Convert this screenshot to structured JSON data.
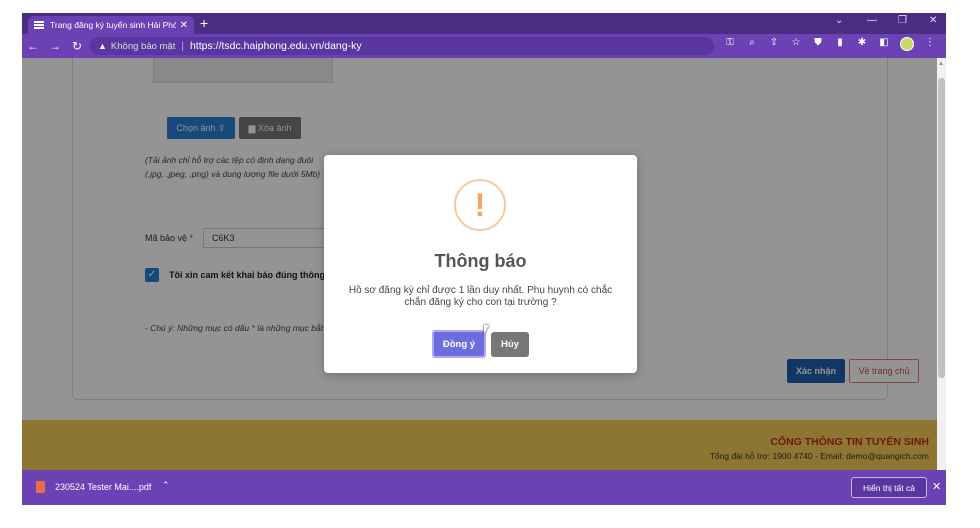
{
  "browser": {
    "tab_title": "Trang đăng ký tuyển sinh Hải Phò",
    "new_tab": "+",
    "tab_close": "✕",
    "security_label": "Không bảo mật",
    "url_scheme": "https://",
    "url_host": "tsdc.haiphong.edu.vn",
    "url_path": "/dang-ky",
    "window_controls": {
      "minimize": "—",
      "restore": "❐",
      "close": "✕",
      "tab_list": "⌄"
    }
  },
  "form": {
    "choose_photo_label": "Chọn ảnh",
    "delete_photo_label": "Xóa ảnh",
    "photo_note_line1": "(Tải ảnh chỉ hỗ trợ các tệp có định dạng đuôi",
    "photo_note_line2": "(.jpg, .jpeg, .png) và dung lượng file dưới 5Mb)",
    "captcha_label": "Mã bảo vệ",
    "required_mark": "*",
    "captcha_value": "C6K3",
    "commit_label": "Tôi xin cam kết khai báo đúng thông tin.",
    "commit_checked": true,
    "footnote_prefix": "- Chú ý: Những mục có dấu",
    "footnote_suffix": "là những mục bắt buộc",
    "confirm_label": "Xác nhận",
    "home_label": "Về trang chủ"
  },
  "footer": {
    "title": "CỔNG THÔNG TIN TUYỂN SINH",
    "hotline_text": "Tổng đài hỗ trợ: 1900 4740 - Email: demo@quangich.com"
  },
  "modal": {
    "icon_glyph": "!",
    "title": "Thông báo",
    "message": "Hồ sơ đăng ký chỉ được 1 lần duy nhất. Phụ huynh có chắc chắn đăng ký cho con tại trường ?",
    "ok_label": "Đồng ý",
    "cancel_label": "Hủy"
  },
  "downloads": {
    "file_name": "230524 Tester Mai....pdf",
    "show_all_label": "Hiển thị tất cả"
  },
  "colors": {
    "browser_frame": "#6a42b3",
    "primary_button": "#2a7fd4",
    "ok_button": "#6c6ee0",
    "warning_icon": "#f2a55b",
    "footer_band": "#f3cc55",
    "footer_title": "#c02a1f"
  }
}
